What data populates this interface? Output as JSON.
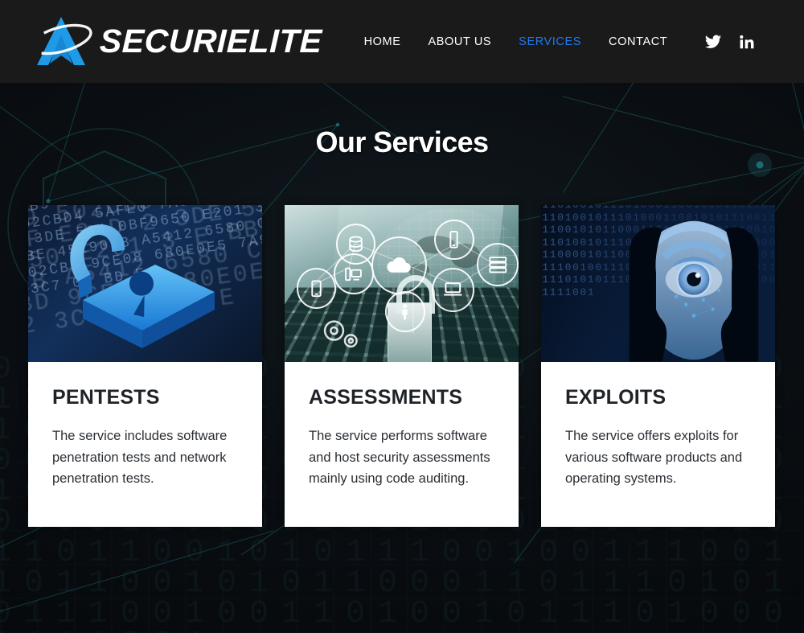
{
  "header": {
    "brand_name": "SECURIELITE",
    "logo_icon": "arrow-swoosh-logo",
    "nav": [
      {
        "label": "HOME",
        "active": false
      },
      {
        "label": "ABOUT US",
        "active": false
      },
      {
        "label": "SERVICES",
        "active": true
      },
      {
        "label": "CONTACT",
        "active": false
      }
    ],
    "socials": [
      {
        "name": "twitter-icon",
        "label": "Twitter"
      },
      {
        "name": "linkedin-icon",
        "label": "LinkedIn"
      }
    ],
    "accent_color": "#1d7af3",
    "background_color": "#1a1a1a"
  },
  "section": {
    "title": "Our Services"
  },
  "cards": [
    {
      "title": "PENTESTS",
      "text": "The service includes software penetration tests and network penetration tests.",
      "image_alt": "blue-padlock-hex-code-image"
    },
    {
      "title": "ASSESSMENTS",
      "text": "The service performs software and host security assessments mainly using code auditing.",
      "image_alt": "laptop-cloud-icons-padlock-image"
    },
    {
      "title": "EXPLOITS",
      "text": "The service offers exploits for various software products and operating systems.",
      "image_alt": "binary-heads-eye-image"
    }
  ],
  "background": {
    "hex_texture": "0AE2B9 0D203 CB8 1 A 3 8 B 9 502CBD4 5AFE0 7A57DAF E3 D 2 3DE 534 0BF9650 E201 3 E BBE 45290EB A5412 6580 C 4 F02CBD 9CE08 680E0E5 7A9 02 3C7 0A BD E",
    "binary_texture": "0110100101110100011001010110110001101001011101000110010101110011011001010110001101110101011100100110100101110100011110010110100001100001011000110110101101100101011100100111001101100101011000110111010101110010011010010111010001111001"
  }
}
